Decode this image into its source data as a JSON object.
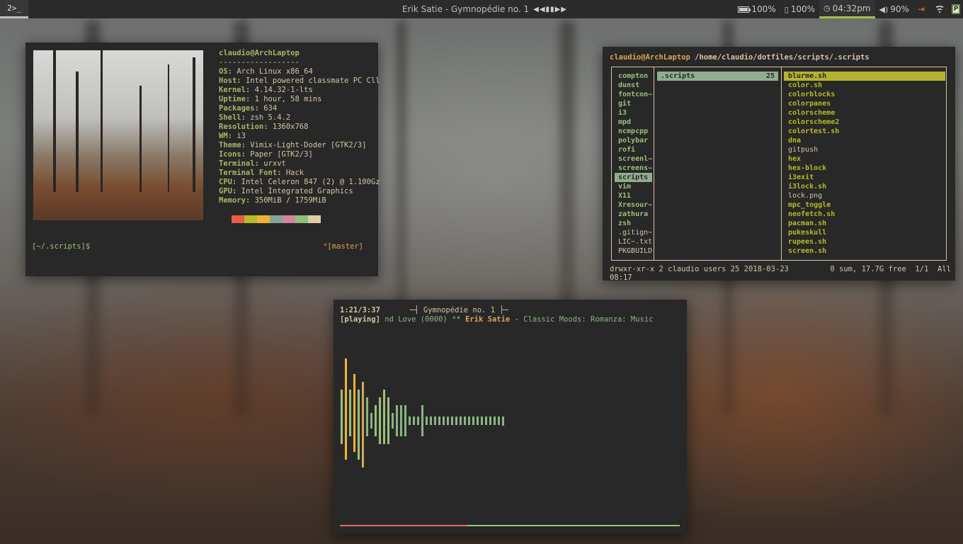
{
  "topbar": {
    "workspace": "2",
    "workspace_icon": "terminal-icon",
    "now_playing": "Erik Satie - Gymnopédie no. 1",
    "controls": "◀◀ ▮▮ ▶▶",
    "modules": [
      {
        "icon": "battery-icon",
        "text": "100%"
      },
      {
        "icon": "battery-icon",
        "text": "100%"
      },
      {
        "icon": "clock-icon",
        "text": "04:32pm"
      },
      {
        "icon": "volume-icon",
        "text": "90%"
      }
    ]
  },
  "neofetch": {
    "user_host": "claudio@ArchLaptop",
    "separator": "------------------",
    "fields": [
      {
        "key": "OS",
        "value": "Arch Linux x86_64"
      },
      {
        "key": "Host",
        "value": "Intel powered classmate PC Cll"
      },
      {
        "key": "Kernel",
        "value": "4.14.32-1-lts"
      },
      {
        "key": "Uptime",
        "value": "1 hour, 58 mins"
      },
      {
        "key": "Packages",
        "value": "634"
      },
      {
        "key": "Shell",
        "value": "zsh 5.4.2"
      },
      {
        "key": "Resolution",
        "value": "1360x768"
      },
      {
        "key": "WM",
        "value": "i3"
      },
      {
        "key": "Theme",
        "value": "Vimix-Light-Doder [GTK2/3]"
      },
      {
        "key": "Icons",
        "value": "Paper [GTK2/3]"
      },
      {
        "key": "Terminal",
        "value": "urxvt"
      },
      {
        "key": "Terminal Font",
        "value": "Hack"
      },
      {
        "key": "CPU",
        "value": "Intel Celeron 847 (2) @ 1.100Gz"
      },
      {
        "key": "GPU",
        "value": "Intel Integrated Graphics"
      },
      {
        "key": "Memory",
        "value": "350MiB / 1759MiB"
      }
    ],
    "palette": [
      "#ea5a47",
      "#b8bb26",
      "#f0b432",
      "#83a598",
      "#d3869b",
      "#8ec07c",
      "#e0cba8"
    ],
    "prompt": "[~/.scripts]$",
    "git_star": "*",
    "git_branch": "[master]"
  },
  "ranger": {
    "user_host": "claudio@ArchLaptop",
    "path": "/home/claudio/dotfiles/scripts/",
    "path_current": ".scripts",
    "col1": [
      {
        "name": "compton",
        "style": "dir"
      },
      {
        "name": "dunst",
        "style": "dir"
      },
      {
        "name": "fontcon~",
        "style": "dir"
      },
      {
        "name": "git",
        "style": "dir"
      },
      {
        "name": "i3",
        "style": "dir"
      },
      {
        "name": "mpd",
        "style": "dir"
      },
      {
        "name": "ncmpcpp",
        "style": "dir"
      },
      {
        "name": "polybar",
        "style": "dir"
      },
      {
        "name": "rofi",
        "style": "dir"
      },
      {
        "name": "screenl~",
        "style": "dir"
      },
      {
        "name": "screens~",
        "style": "dir"
      },
      {
        "name": "scripts",
        "style": "sel"
      },
      {
        "name": "vim",
        "style": "dir"
      },
      {
        "name": "X11",
        "style": "dir"
      },
      {
        "name": "Xresour~",
        "style": "dir"
      },
      {
        "name": "zathura",
        "style": "dir"
      },
      {
        "name": "zsh",
        "style": "dir"
      },
      {
        "name": ".gitign~",
        "style": "plain"
      },
      {
        "name": "LIC~.txt",
        "style": "plain"
      },
      {
        "name": "PKGBUILD",
        "style": "plain"
      }
    ],
    "col2_selected": ".scripts",
    "col2_count": "25",
    "col3": [
      {
        "name": "blurme.sh",
        "style": "sel"
      },
      {
        "name": "color.sh",
        "style": "exec"
      },
      {
        "name": "colorblocks",
        "style": "exec"
      },
      {
        "name": "colorpanes",
        "style": "exec"
      },
      {
        "name": "colorscheme",
        "style": "exec"
      },
      {
        "name": "colorscheme2",
        "style": "exec"
      },
      {
        "name": "colortest.sh",
        "style": "exec"
      },
      {
        "name": "dna",
        "style": "exec"
      },
      {
        "name": "gitpush",
        "style": "plain"
      },
      {
        "name": "hex",
        "style": "exec"
      },
      {
        "name": "hex-block",
        "style": "exec"
      },
      {
        "name": "i3exit",
        "style": "exec"
      },
      {
        "name": "i3lock.sh",
        "style": "exec"
      },
      {
        "name": "lock.png",
        "style": "plain"
      },
      {
        "name": "mpc_toggle",
        "style": "exec"
      },
      {
        "name": "neofetch.sh",
        "style": "exec"
      },
      {
        "name": "pacman.sh",
        "style": "exec"
      },
      {
        "name": "pukeskull",
        "style": "exec"
      },
      {
        "name": "rupees.sh",
        "style": "exec"
      },
      {
        "name": "screen.sh",
        "style": "exec"
      }
    ],
    "status_left": "drwxr-xr-x 2 claudio users 25 2018-03-23 08:17",
    "status_right": "0 sum, 17.7G free  1/1  All"
  },
  "ncmpcpp": {
    "time": "1:21/3:37",
    "title_line": "─┤ Gymnopédie no. 1 ├─",
    "state": "[playing]",
    "scroll_text": " nd Love (0000) ** ",
    "artist": "Erik Satie",
    "dash": " - ",
    "album": "Classic Moods: Romanza: Music",
    "progress": 0.375,
    "visualizer": [
      {
        "up": 4,
        "down": 3,
        "c": "#9cc07a"
      },
      {
        "up": 8,
        "down": 5,
        "c": "#f0b432"
      },
      {
        "up": 4,
        "down": 2,
        "c": "#9cc07a"
      },
      {
        "up": 6,
        "down": 4,
        "c": "#f0b432"
      },
      {
        "up": 4,
        "down": 5,
        "c": "#9cc07a"
      },
      {
        "up": 5,
        "down": 6,
        "c": "#d8a657"
      },
      {
        "up": 3,
        "down": 2,
        "c": "#89b482"
      },
      {
        "up": 1,
        "down": 1,
        "c": "#89b482"
      },
      {
        "up": 2,
        "down": 2,
        "c": "#9cc07a"
      },
      {
        "up": 3,
        "down": 3,
        "c": "#9cc07a"
      },
      {
        "up": 4,
        "down": 3,
        "c": "#9cc07a"
      },
      {
        "up": 3,
        "down": 3,
        "c": "#9cc07a"
      },
      {
        "up": 1,
        "down": 1,
        "c": "#89b482"
      },
      {
        "up": 2,
        "down": 2,
        "c": "#89b482"
      },
      {
        "up": 2,
        "down": 2,
        "c": "#89b482"
      },
      {
        "up": 2,
        "down": 2,
        "c": "#89b482"
      },
      {
        "up": 0,
        "down": 0,
        "c": "#89b482"
      },
      {
        "up": 0,
        "down": 0,
        "c": "#89b482"
      },
      {
        "up": 0,
        "down": 0,
        "c": "#89b482"
      },
      {
        "up": 2,
        "down": 2,
        "c": "#89b482"
      },
      {
        "up": 0,
        "down": 0,
        "c": "#89b482"
      },
      {
        "up": 0,
        "down": 0,
        "c": "#89b482"
      },
      {
        "up": 0,
        "down": 0,
        "c": "#89b482"
      },
      {
        "up": 0,
        "down": 0,
        "c": "#89b482"
      },
      {
        "up": 0,
        "down": 0,
        "c": "#89b482"
      },
      {
        "up": 0,
        "down": 0,
        "c": "#89b482"
      },
      {
        "up": 0,
        "down": 0,
        "c": "#89b482"
      },
      {
        "up": 0,
        "down": 0,
        "c": "#89b482"
      },
      {
        "up": 0,
        "down": 0,
        "c": "#89b482"
      },
      {
        "up": 0,
        "down": 0,
        "c": "#89b482"
      },
      {
        "up": 0,
        "down": 0,
        "c": "#89b482"
      },
      {
        "up": 0,
        "down": 0,
        "c": "#89b482"
      },
      {
        "up": 0,
        "down": 0,
        "c": "#89b482"
      },
      {
        "up": 0,
        "down": 0,
        "c": "#89b482"
      },
      {
        "up": 0,
        "down": 0,
        "c": "#89b482"
      },
      {
        "up": 0,
        "down": 0,
        "c": "#89b482"
      },
      {
        "up": 0,
        "down": 0,
        "c": "#89b482"
      },
      {
        "up": 0,
        "down": 0,
        "c": "#89b482"
      },
      {
        "up": 0,
        "down": 0,
        "c": "#89b482"
      }
    ]
  }
}
